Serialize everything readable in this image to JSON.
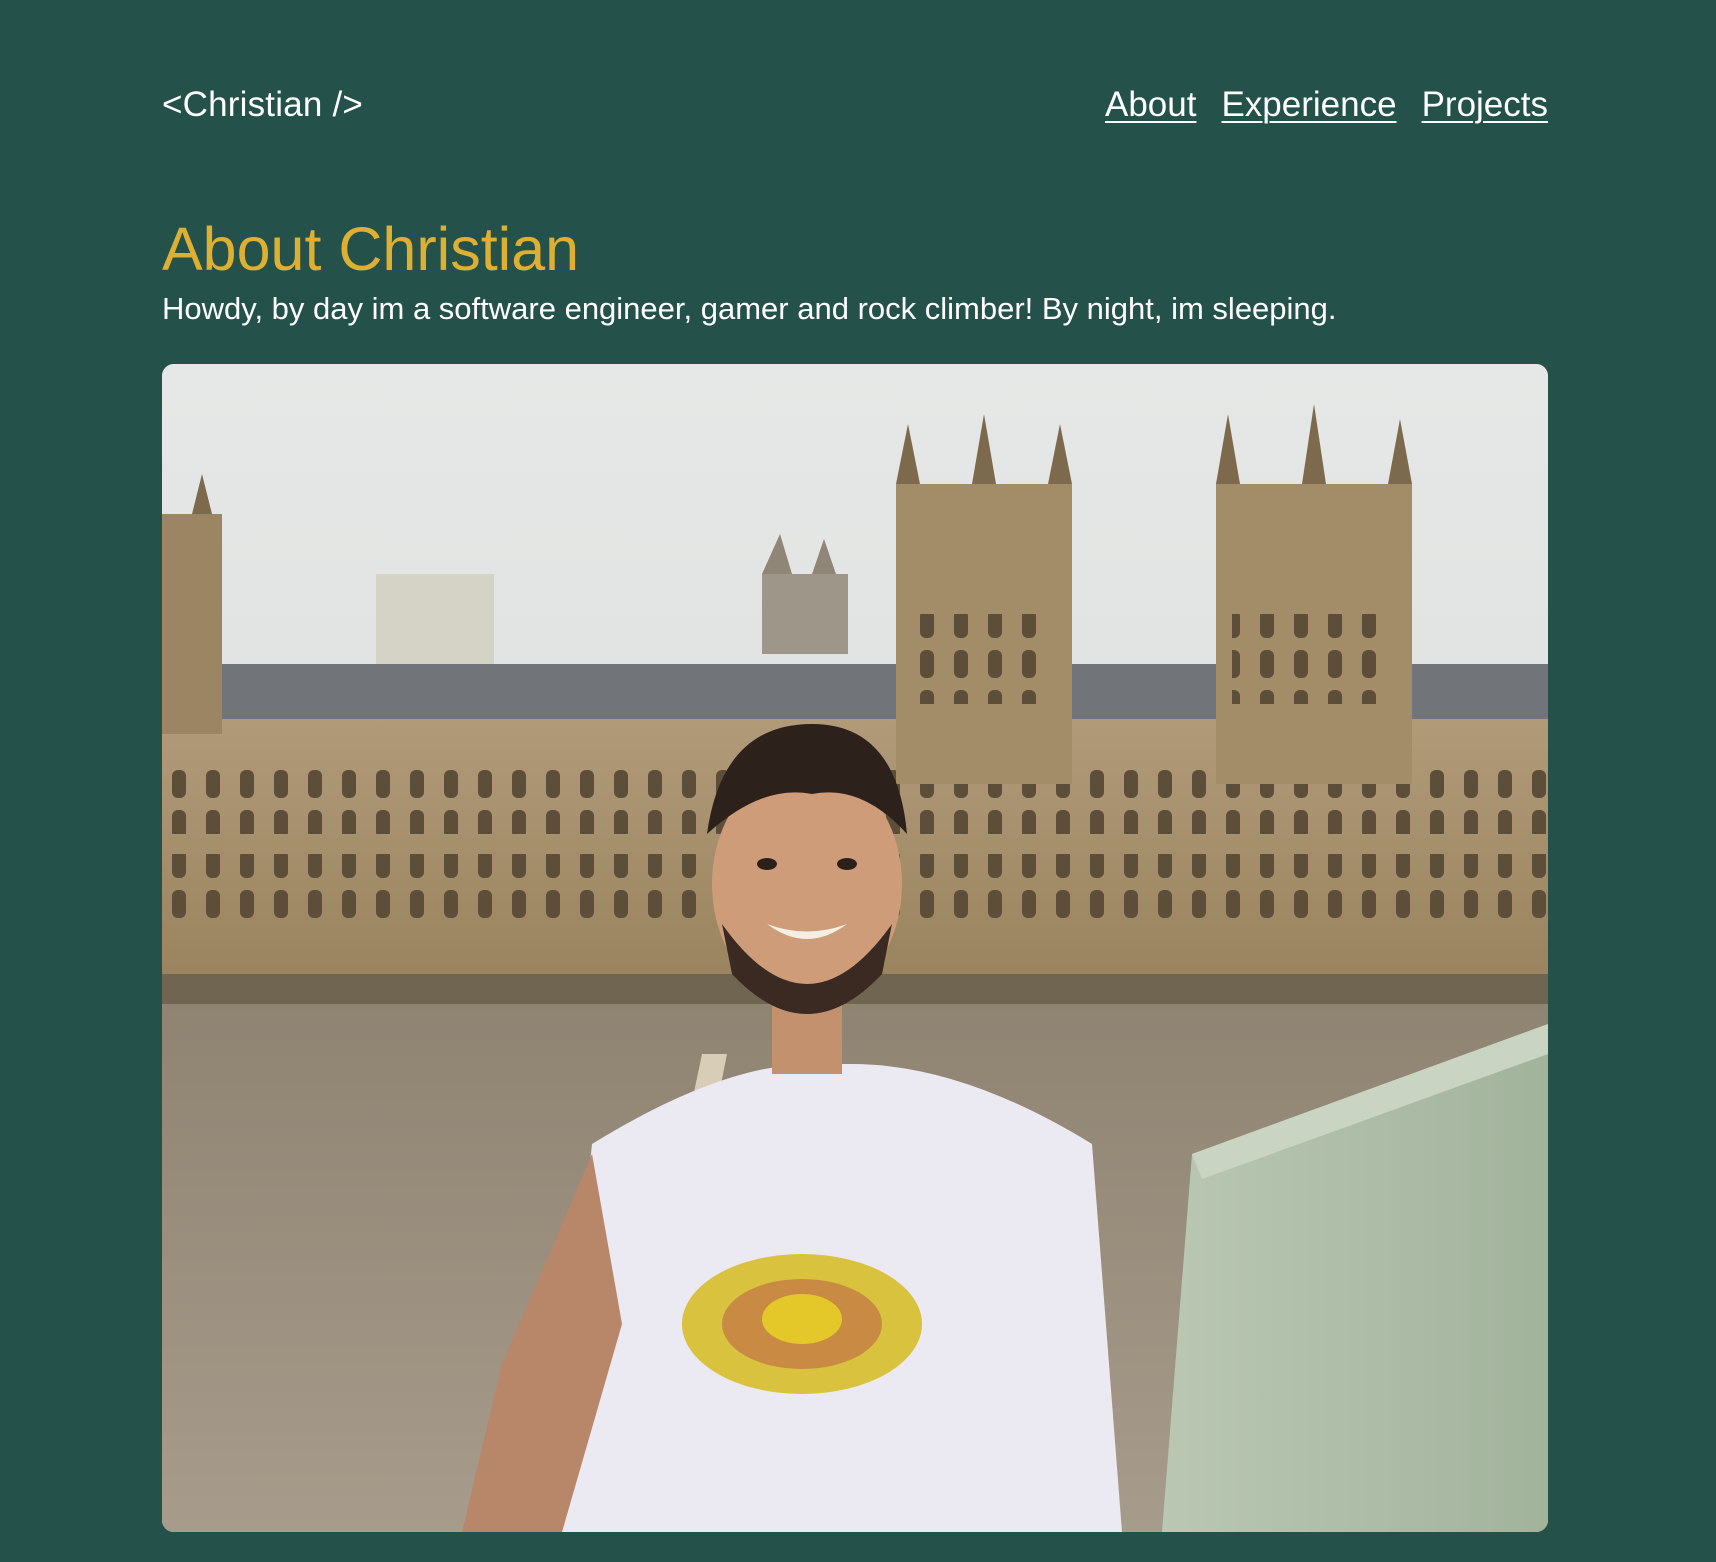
{
  "header": {
    "logo": "<Christian />",
    "nav": [
      {
        "label": "About"
      },
      {
        "label": "Experience"
      },
      {
        "label": "Projects"
      }
    ]
  },
  "about": {
    "heading": "About Christian",
    "intro": "Howdy, by day im a software engineer, gamer and rock climber! By night, im sleeping."
  },
  "colors": {
    "background": "#24514a",
    "heading": "#ddb033",
    "text": "#ffffff"
  }
}
